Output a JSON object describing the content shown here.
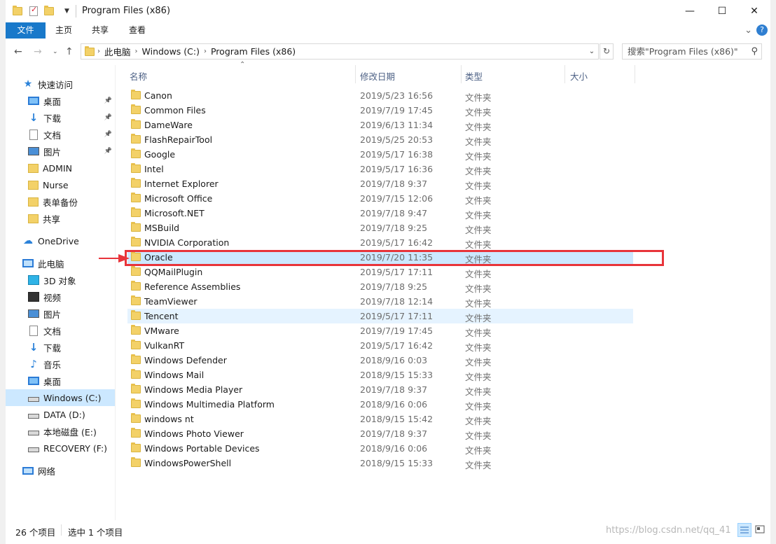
{
  "window": {
    "title": "Program Files (x86)",
    "minimize_glyph": "—",
    "maximize_glyph": "☐",
    "close_glyph": "✕"
  },
  "ribbon": {
    "tabs": [
      "文件",
      "主页",
      "共享",
      "查看"
    ],
    "expand_glyph": "⌄",
    "help_glyph": "?"
  },
  "address": {
    "crumbs": [
      "此电脑",
      "Windows (C:)",
      "Program Files (x86)"
    ],
    "search_placeholder": "搜索\"Program Files (x86)\""
  },
  "nav_pane": {
    "quick_access_label": "快速访问",
    "quick_access_items": [
      {
        "label": "桌面",
        "icon": "desktop-icon",
        "pinned": true
      },
      {
        "label": "下载",
        "icon": "download-icon",
        "pinned": true
      },
      {
        "label": "文档",
        "icon": "document-icon",
        "pinned": true
      },
      {
        "label": "图片",
        "icon": "pictures-icon",
        "pinned": true
      },
      {
        "label": "ADMIN",
        "icon": "folder-icon",
        "pinned": false
      },
      {
        "label": "Nurse",
        "icon": "folder-icon",
        "pinned": false
      },
      {
        "label": "表单备份",
        "icon": "folder-icon",
        "pinned": false
      },
      {
        "label": "共享",
        "icon": "folder-icon",
        "pinned": false
      }
    ],
    "onedrive_label": "OneDrive",
    "this_pc_label": "此电脑",
    "this_pc_items": [
      {
        "label": "3D 对象",
        "icon": "cube-icon"
      },
      {
        "label": "视频",
        "icon": "video-icon"
      },
      {
        "label": "图片",
        "icon": "pictures-icon"
      },
      {
        "label": "文档",
        "icon": "document-icon"
      },
      {
        "label": "下载",
        "icon": "download-icon"
      },
      {
        "label": "音乐",
        "icon": "music-icon"
      },
      {
        "label": "桌面",
        "icon": "desktop-icon"
      },
      {
        "label": "Windows (C:)",
        "icon": "drive-icon",
        "selected": true
      },
      {
        "label": "DATA (D:)",
        "icon": "drive-icon"
      },
      {
        "label": "本地磁盘 (E:)",
        "icon": "drive-icon"
      },
      {
        "label": "RECOVERY (F:)",
        "icon": "drive-icon"
      }
    ],
    "network_label": "网络"
  },
  "columns": {
    "name": "名称",
    "modified": "修改日期",
    "type": "类型",
    "size": "大小"
  },
  "files": [
    {
      "name": "Canon",
      "date": "2019/5/23 16:56",
      "type": "文件夹"
    },
    {
      "name": "Common Files",
      "date": "2019/7/19 17:45",
      "type": "文件夹"
    },
    {
      "name": "DameWare",
      "date": "2019/6/13 11:34",
      "type": "文件夹"
    },
    {
      "name": "FlashRepairTool",
      "date": "2019/5/25 20:53",
      "type": "文件夹"
    },
    {
      "name": "Google",
      "date": "2019/5/17 16:38",
      "type": "文件夹"
    },
    {
      "name": "Intel",
      "date": "2019/5/17 16:36",
      "type": "文件夹"
    },
    {
      "name": "Internet Explorer",
      "date": "2019/7/18 9:37",
      "type": "文件夹"
    },
    {
      "name": "Microsoft Office",
      "date": "2019/7/15 12:06",
      "type": "文件夹"
    },
    {
      "name": "Microsoft.NET",
      "date": "2019/7/18 9:47",
      "type": "文件夹"
    },
    {
      "name": "MSBuild",
      "date": "2019/7/18 9:25",
      "type": "文件夹"
    },
    {
      "name": "NVIDIA Corporation",
      "date": "2019/5/17 16:42",
      "type": "文件夹"
    },
    {
      "name": "Oracle",
      "date": "2019/7/20 11:35",
      "type": "文件夹",
      "state": "selected"
    },
    {
      "name": "QQMailPlugin",
      "date": "2019/5/17 17:11",
      "type": "文件夹"
    },
    {
      "name": "Reference Assemblies",
      "date": "2019/7/18 9:25",
      "type": "文件夹"
    },
    {
      "name": "TeamViewer",
      "date": "2019/7/18 12:14",
      "type": "文件夹"
    },
    {
      "name": "Tencent",
      "date": "2019/5/17 17:11",
      "type": "文件夹",
      "state": "hover"
    },
    {
      "name": "VMware",
      "date": "2019/7/19 17:45",
      "type": "文件夹"
    },
    {
      "name": "VulkanRT",
      "date": "2019/5/17 16:42",
      "type": "文件夹"
    },
    {
      "name": "Windows Defender",
      "date": "2018/9/16 0:03",
      "type": "文件夹"
    },
    {
      "name": "Windows Mail",
      "date": "2018/9/15 15:33",
      "type": "文件夹"
    },
    {
      "name": "Windows Media Player",
      "date": "2019/7/18 9:37",
      "type": "文件夹"
    },
    {
      "name": "Windows Multimedia Platform",
      "date": "2018/9/16 0:06",
      "type": "文件夹"
    },
    {
      "name": "windows nt",
      "date": "2018/9/15 15:42",
      "type": "文件夹"
    },
    {
      "name": "Windows Photo Viewer",
      "date": "2019/7/18 9:37",
      "type": "文件夹"
    },
    {
      "name": "Windows Portable Devices",
      "date": "2018/9/16 0:06",
      "type": "文件夹"
    },
    {
      "name": "WindowsPowerShell",
      "date": "2018/9/15 15:33",
      "type": "文件夹"
    }
  ],
  "status": {
    "item_count": "26 个项目",
    "selected_count": "选中 1 个项目",
    "watermark": "https://blog.csdn.net/qq_41"
  },
  "colors": {
    "accent": "#1979ca",
    "selection": "#cce8ff",
    "hover": "#e5f3ff",
    "annotation_red": "#e8343a"
  }
}
